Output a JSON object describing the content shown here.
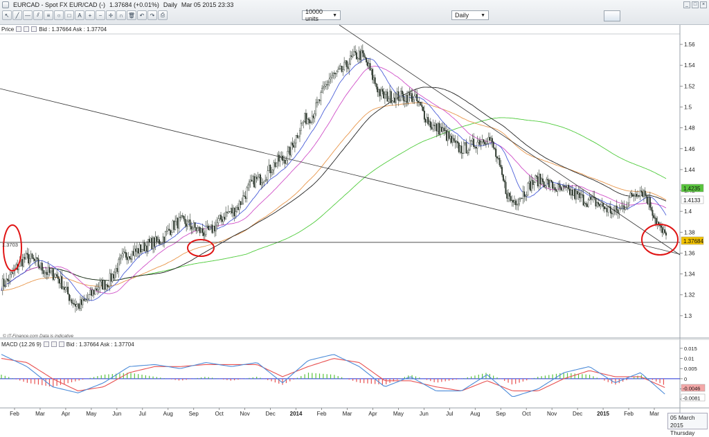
{
  "header": {
    "symbol": "EURCAD - Spot FX EUR/CAD (-)",
    "last": "1.37684 (+0.01%)",
    "interval": "Daily",
    "datetime": "Mar 05 2015 23:33",
    "units_select": "10000 units",
    "period_select": "Daily"
  },
  "price_pane": {
    "label": "Price",
    "bid_ask": "Bid : 1.37664 Ask : 1.37704",
    "watermark": "© IT-Finance.com  Data is indicative",
    "hline_label": "1.3703",
    "tags": [
      {
        "text": "1.4235",
        "color": "#58c43c"
      },
      {
        "text": "1.4133",
        "color": "#ffffff"
      },
      {
        "text": "1.37684",
        "color": "#f2c200"
      }
    ]
  },
  "macd_pane": {
    "label": "MACD (12.26 9)",
    "bid_ask": "Bid : 1.37664 Ask : 1.37704",
    "tags": [
      {
        "text": "-0.0046",
        "color": "#f4a8a8"
      },
      {
        "text": "-0.0081",
        "color": "#ffffff"
      }
    ]
  },
  "time_axis": {
    "labels": [
      "Feb",
      "Mar",
      "Apr",
      "May",
      "Jun",
      "Jul",
      "Aug",
      "Sep",
      "Oct",
      "Nov",
      "Dec",
      "2014",
      "Feb",
      "Mar",
      "Apr",
      "May",
      "Jun",
      "Jul",
      "Aug",
      "Sep",
      "Oct",
      "Nov",
      "Dec",
      "2015",
      "Feb",
      "Mar"
    ],
    "bold": [
      "2014",
      "2015"
    ]
  },
  "datebox": {
    "date": "05 March 2015",
    "day": "Thursday"
  },
  "colors": {
    "candle": "#2f3a2f",
    "ma_fast": "#4a5ed8",
    "ma_mid": "#d050c8",
    "ma_100": "#222222",
    "ma_ema": "#e8964a",
    "ma_200": "#4ecb3a",
    "macd": "#4a8ad8",
    "signal": "#e85050",
    "hist_pos": "#58c43c",
    "hist_neg": "#e85050",
    "circle": "#e01515"
  },
  "chart_data": [
    {
      "type": "candlestick",
      "title": "EURCAD - Spot FX EUR/CAD (-)",
      "x_range": [
        "2013-01",
        "2015-03-05"
      ],
      "ylim": [
        1.28,
        1.57
      ],
      "y_ticks": [
        "1.56",
        "1.54",
        "1.52",
        "1.5",
        "1.48",
        "1.46",
        "1.44",
        "1.42",
        "1.4",
        "1.38",
        "1.36",
        "1.34",
        "1.32",
        "1.3"
      ],
      "x": [
        "2013-01",
        "2013-02",
        "2013-03",
        "2013-04",
        "2013-05",
        "2013-06",
        "2013-07",
        "2013-08",
        "2013-09",
        "2013-10",
        "2013-11",
        "2013-12",
        "2014-01",
        "2014-02",
        "2014-03",
        "2014-04",
        "2014-05",
        "2014-06",
        "2014-07",
        "2014-08",
        "2014-09",
        "2014-10",
        "2014-11",
        "2014-12",
        "2015-01",
        "2015-02",
        "2015-03"
      ],
      "series": [
        {
          "values": [
            1.33,
            1.355,
            1.34,
            1.31,
            1.33,
            1.36,
            1.37,
            1.39,
            1.38,
            1.4,
            1.43,
            1.45,
            1.49,
            1.53,
            1.55,
            1.51,
            1.51,
            1.48,
            1.46,
            1.47,
            1.41,
            1.43,
            1.42,
            1.41,
            1.4,
            1.42,
            1.377
          ]
        }
      ],
      "horizontal_line": 1.3703
    },
    {
      "type": "line",
      "title": "MACD (12.26 9)",
      "ylim": [
        -0.012,
        0.016
      ],
      "y_ticks": [
        "0.015",
        "0.01",
        "0.005",
        "0",
        "-0.005",
        "-0.01"
      ],
      "x": [
        "2013-01",
        "2013-02",
        "2013-03",
        "2013-04",
        "2013-05",
        "2013-06",
        "2013-07",
        "2013-08",
        "2013-09",
        "2013-10",
        "2013-11",
        "2013-12",
        "2014-01",
        "2014-02",
        "2014-03",
        "2014-04",
        "2014-05",
        "2014-06",
        "2014-07",
        "2014-08",
        "2014-09",
        "2014-10",
        "2014-11",
        "2014-12",
        "2015-01",
        "2015-02",
        "2015-03"
      ],
      "series": [
        {
          "values": [
            0.012,
            0.006,
            -0.004,
            -0.007,
            -0.002,
            0.006,
            0.007,
            0.005,
            0.008,
            0.006,
            0.008,
            -0.002,
            0.009,
            0.012,
            0.006,
            -0.004,
            0.001,
            -0.006,
            -0.006,
            0.002,
            -0.009,
            -0.005,
            0.003,
            0.006,
            -0.002,
            0.003,
            -0.0081
          ]
        },
        {
          "values": [
            0.01,
            0.008,
            0.0,
            -0.006,
            -0.004,
            0.003,
            0.006,
            0.006,
            0.007,
            0.007,
            0.007,
            0.001,
            0.006,
            0.01,
            0.008,
            -0.001,
            -0.001,
            -0.004,
            -0.006,
            -0.001,
            -0.006,
            -0.006,
            0.0,
            0.004,
            0.001,
            0.001,
            -0.0046
          ]
        }
      ]
    }
  ]
}
